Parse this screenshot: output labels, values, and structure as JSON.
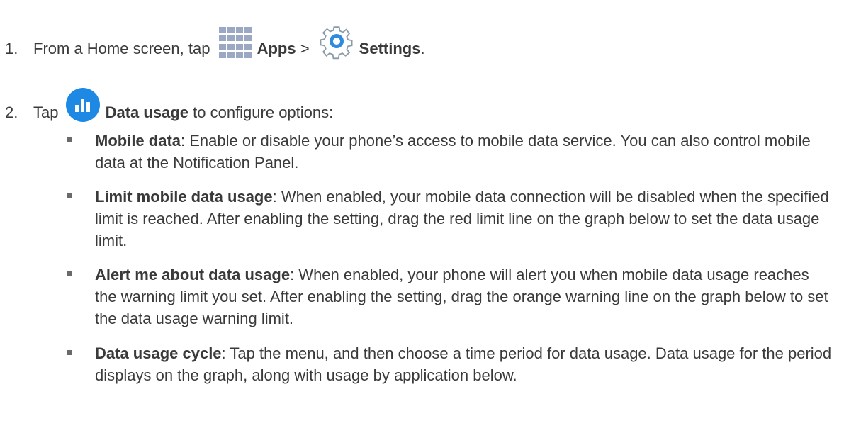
{
  "steps": [
    {
      "number": "1.",
      "text_before": "From a Home screen, tap",
      "icon1": "apps-grid-icon",
      "label1": "Apps",
      "separator": ">",
      "icon2": "settings-gear-icon",
      "label2": "Settings",
      "end": "."
    },
    {
      "number": "2.",
      "text_before": "Tap",
      "icon1": "data-usage-icon",
      "label1": "Data usage",
      "text_after": "to configure options:"
    }
  ],
  "bullets": [
    {
      "term": "Mobile data",
      "description": ": Enable or disable your phone’s access to mobile data service. You can also control mobile data at the Notification Panel."
    },
    {
      "term": "Limit mobile data usage",
      "description": ": When enabled, your mobile data connection will be disabled when the specified limit is reached. After enabling the setting, drag the red limit line on the graph below to set the data usage limit."
    },
    {
      "term": "Alert me about data usage",
      "description": ": When enabled, your phone will alert you when mobile data usage reaches the warning limit you set. After enabling the setting, drag the orange warning line on the graph below to set the data usage warning limit."
    },
    {
      "term": "Data usage cycle",
      "description": ": Tap the menu, and then choose a time period for data usage. Data usage for the period displays on the graph, along with usage by application below."
    }
  ],
  "colors": {
    "text": "#3a3a3a",
    "apps_icon": "#9aa8c4",
    "gear_blue": "#2f8be0",
    "data_icon_blue": "#1e88e5"
  }
}
